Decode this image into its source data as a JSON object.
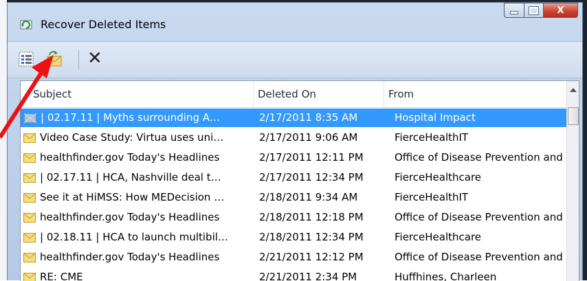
{
  "window": {
    "title": "Recover Deleted Items",
    "controls": {
      "minimize": "—",
      "maximize": "□",
      "close": "X"
    }
  },
  "toolbar": {
    "buttons": [
      {
        "name": "select-all",
        "icon": "select-all-icon"
      },
      {
        "name": "recover",
        "icon": "recover-envelope-icon"
      },
      {
        "name": "purge",
        "icon": "delete-x-icon",
        "label": "✕"
      }
    ]
  },
  "columns": {
    "subject": "Subject",
    "deleted_on": "Deleted On",
    "from": "From"
  },
  "rows": [
    {
      "subject": "| 02.17.11 | Myths surrounding A…",
      "deleted_on": "2/17/2011 8:35 AM",
      "from": "Hospital Impact",
      "icon": "unread-item-icon",
      "selected": true
    },
    {
      "subject": "Video Case Study: Virtua uses uni…",
      "deleted_on": "2/17/2011 9:06 AM",
      "from": "FierceHealthIT",
      "icon": "envelope-icon"
    },
    {
      "subject": "healthfinder.gov Today's Headlines",
      "deleted_on": "2/17/2011 12:11 PM",
      "from": "Office of Disease Prevention and",
      "icon": "envelope-icon"
    },
    {
      "subject": "| 02.17.11 | HCA, Nashville deal t…",
      "deleted_on": "2/17/2011 12:34 PM",
      "from": "FierceHealthcare",
      "icon": "envelope-icon"
    },
    {
      "subject": "See it at HiMSS: How MEDecision …",
      "deleted_on": "2/18/2011 9:34 AM",
      "from": "FierceHealthIT",
      "icon": "envelope-icon"
    },
    {
      "subject": "healthfinder.gov Today's Headlines",
      "deleted_on": "2/18/2011 12:18 PM",
      "from": "Office of Disease Prevention and",
      "icon": "envelope-icon"
    },
    {
      "subject": "| 02.18.11 | HCA to launch multibil…",
      "deleted_on": "2/18/2011 12:34 PM",
      "from": "FierceHealthcare",
      "icon": "envelope-icon"
    },
    {
      "subject": "healthfinder.gov Today's Headlines",
      "deleted_on": "2/21/2011 12:12 PM",
      "from": "Office of Disease Prevention and",
      "icon": "envelope-icon"
    },
    {
      "subject": "RE: CME",
      "deleted_on": "2/21/2011 2:34 PM",
      "from": "Huffhines, Charleen",
      "icon": "envelope-icon"
    }
  ],
  "colors": {
    "selection": "#3399ff",
    "annotation_arrow": "#ee1111",
    "close_button": "#c9452f"
  }
}
